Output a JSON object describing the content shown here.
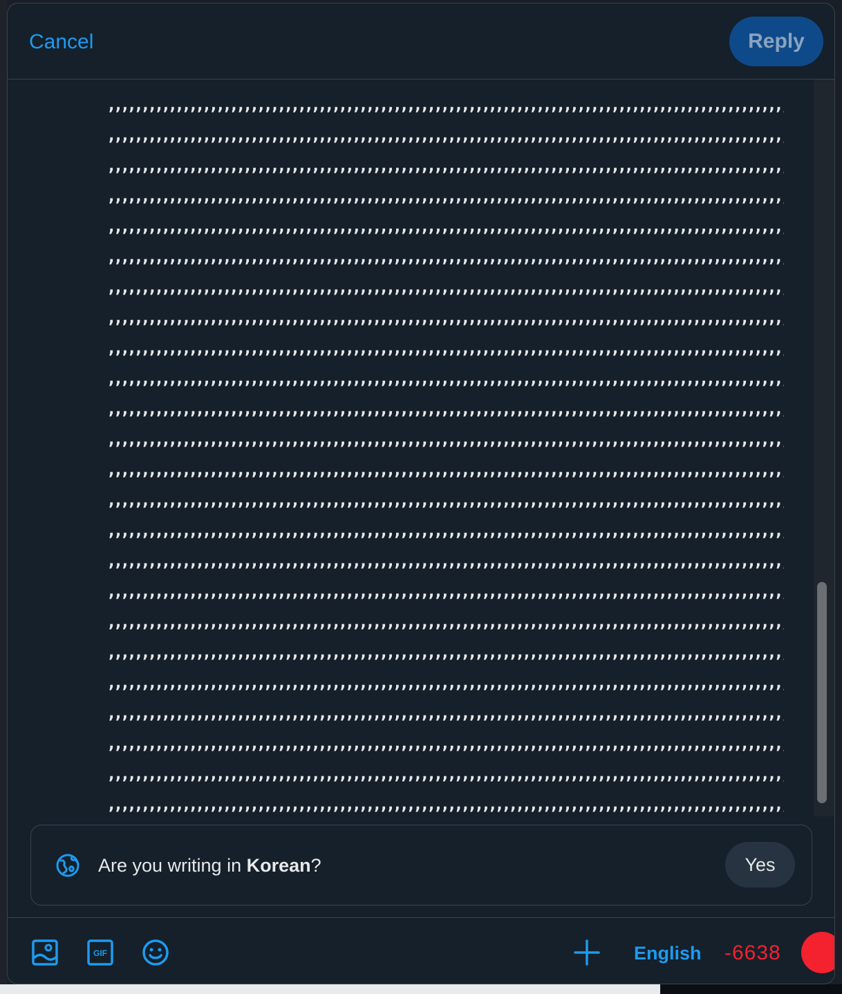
{
  "header": {
    "cancel_label": "Cancel",
    "reply_label": "Reply"
  },
  "editor": {
    "lines": [
      ",,,,,,,,,,,,,,,,,,,,,,,,,,,,,,,,,,,,,,,,,,,,,,,,,,,,,,,,,,,,,,,,,,,,,,,,,,,,,,,,,,,,,,,,,,,,,,,,,,,,,,,,,",
      ",,,,,,,,,,,,,,,,,,,,,,,,,,,,,,,,,,,,,,,,,,,,,,,,,,,,,,,,,,,,,,,,,,,,,,,,,,,,,,,,,,,,,,,,,,,,,,,,,,,,,,,,,",
      ",,,,,,,,,,,,,,,,,,,,,,,,,,,,,,,,,,,,,,,,,,,,,,,,,,,,,,,,,,,,,,,,,,,,,,,,,,,,,,,,,,,,,,,,,,,,,,,,,,,,,,,,,",
      ",,,,,,,,,,,,,,,,,,,,,,,,,,,,,,,,,,,,,,,,,,,,,,,,,,,,,,,,,,,,,,,,,,,,,,,,,,,,,,,,,,,,,,,,,,,,,,,,,,,,,,,,,",
      ",,,,,,,,,,,,,,,,,,,,,,,,,,,,,,,,,,,,,,,,,,,,,,,,,,,,,,,,,,,,,,,,,,,,,,,,,,,,,,,,,,,,,,,,,,,,,,,,,,,,,,,,,",
      ",,,,,,,,,,,,,,,,,,,,,,,,,,,,,,,,,,,,,,,,,,,,,,,,,,,,,,,,,,,,,,,,,,,,,,,,,,,,,,,,,,,,,,,,,,,,,,,,,,,,,,,,,",
      ",,,,,,,,,,,,,,,,,,,,,,,,,,,,,,,,,,,,,,,,,,,,,,,,,,,,,,,,,,,,,,,,,,,,,,,,,,,,,,,,,,,,,,,,,,,,,,,,,,,,,,,,,",
      ",,,,,,,,,,,,,,,,,,,,,,,,,,,,,,,,,,,,,,,,,,,,,,,,,,,,,,,,,,,,,,,,,,,,,,,,,,,,,,,,,,,,,,,,,,,,,,,,,,,,,,,,,",
      ",,,,,,,,,,,,,,,,,,,,,,,,,,,,,,,,,,,,,,,,,,,,,,,,,,,,,,,,,,,,,,,,,,,,,,,,,,,,,,,,,,,,,,,,,,,,,,,,,,,,,,,,,",
      ",,,,,,,,,,,,,,,,,,,,,,,,,,,,,,,,,,,,,,,,,,,,,,,,,,,,,,,,,,,,,,,,,,,,,,,,,,,,,,,,,,,,,,,,,,,,,,,,,,,,,,,,,",
      ",,,,,,,,,,,,,,,,,,,,,,,,,,,,,,,,,,,,,,,,,,,,,,,,,,,,,,,,,,,,,,,,,,,,,,,,,,,,,,,,,,,,,,,,,,,,,,,,,,,,,,,,,",
      ",,,,,,,,,,,,,,,,,,,,,,,,,,,,,,,,,,,,,,,,,,,,,,,,,,,,,,,,,,,,,,,,,,,,,,,,,,,,,,,,,,,,,,,,,,,,,,,,,,,,,,,,,",
      ",,,,,,,,,,,,,,,,,,,,,,,,,,,,,,,,,,,,,,,,,,,,,,,,,,,,,,,,,,,,,,,,,,,,,,,,,,,,,,,,,,,,,,,,,,,,,,,,,,,,,,,,,",
      ",,,,,,,,,,,,,,,,,,,,,,,,,,,,,,,,,,,,,,,,,,,,,,,,,,,,,,,,,,,,,,,,,,,,,,,,,,,,,,,,,,,,,,,,,,,,,,,,,,,,,,,,,",
      ",,,,,,,,,,,,,,,,,,,,,,,,,,,,,,,,,,,,,,,,,,,,,,,,,,,,,,,,,,,,,,,,,,,,,,,,,,,,,,,,,,,,,,,,,,,,,,,,,,,,,,,,,",
      ",,,,,,,,,,,,,,,,,,,,,,,,,,,,,,,,,,,,,,,,,,,,,,,,,,,,,,,,,,,,,,,,,,,,,,,,,,,,,,,,,,,,,,,,,,,,,,,,,,,,,,,,,",
      ",,,,,,,,,,,,,,,,,,,,,,,,,,,,,,,,,,,,,,,,,,,,,,,,,,,,,,,,,,,,,,,,,,,,,,,,,,,,,,,,,,,,,,,,,,,,,,,,,,,,,,,,,",
      ",,,,,,,,,,,,,,,,,,,,,,,,,,,,,,,,,,,,,,,,,,,,,,,,,,,,,,,,,,,,,,,,,,,,,,,,,,,,,,,,,,,,,,,,,,,,,,,,,,,,,,,,,",
      ",,,,,,,,,,,,,,,,,,,,,,,,,,,,,,,,,,,,,,,,,,,,,,,,,,,,,,,,,,,,,,,,,,,,,,,,,,,,,,,,,,,,,,,,,,,,,,,,,,,,,,,,,",
      ",,,,,,,,,,,,,,,,,,,,,,,,,,,,,,,,,,,,,,,,,,,,,,,,,,,,,,,,,,,,,,,,,,,,,,,,,,,,,,,,,,,,,,,,,,,,,,,,,,,,,,,,,",
      ",,,,,,,,,,,,,,,,,,,,,,,,,,,,,,,,,,,,,,,,,,,,,,,,,,,,,,,,,,,,,,,,,,,,,,,,,,,,,,,,,,,,,,,,,,,,,,,,,,,,,,,,,",
      ",,,,,,,,,,,,,,,,,,,,,,,,,,,,,,,,,,,,,,,,,,,,,,,,,,,,,,,,,,,,,,,,,,,,,,,,,,,,,,,,,,,,,,,,,,,,,,,,,,,,,,,,,",
      ",,,,,,,,,,,,,,,,,,,,,,,,,,,,,,,,,,,,,,,,,,,,,,,,,,,,,,,,,,,,,,,,,,,,,,,,,,,,,,,,,,,,,,,,,,,,,,,,,,,,,,,,,",
      ",,,,,,,,,,,,,,,,,,,,,,,,,,,,,,,,,,,,,,,,,,,,,,,,,,,,,,,,,,,,,,,,,,,,,,,,,,,,,,,,,,,,,,,,,,,,,,,,,,,,,,,,,"
    ],
    "last_line": ",,,,,,,,,,,,,,,,,,,,,,,,,,,,,,,,,,,,,,,,,,,,,,,,,,,,,,,,,,,,,,,,,,,,,,,,,<,,,,,"
  },
  "language_prompt": {
    "question_prefix": "Are you writing in ",
    "language": "Korean",
    "question_suffix": "?",
    "yes_label": "Yes"
  },
  "toolbar": {
    "icons": [
      "image-icon",
      "gif-icon",
      "emoji-icon",
      "add-icon"
    ],
    "gif_label": "GIF",
    "language_label": "English",
    "char_remaining": "-6638"
  },
  "colors": {
    "accent": "#1d9bf0",
    "error": "#f4212e",
    "background": "#15202b",
    "border": "#38444d"
  }
}
